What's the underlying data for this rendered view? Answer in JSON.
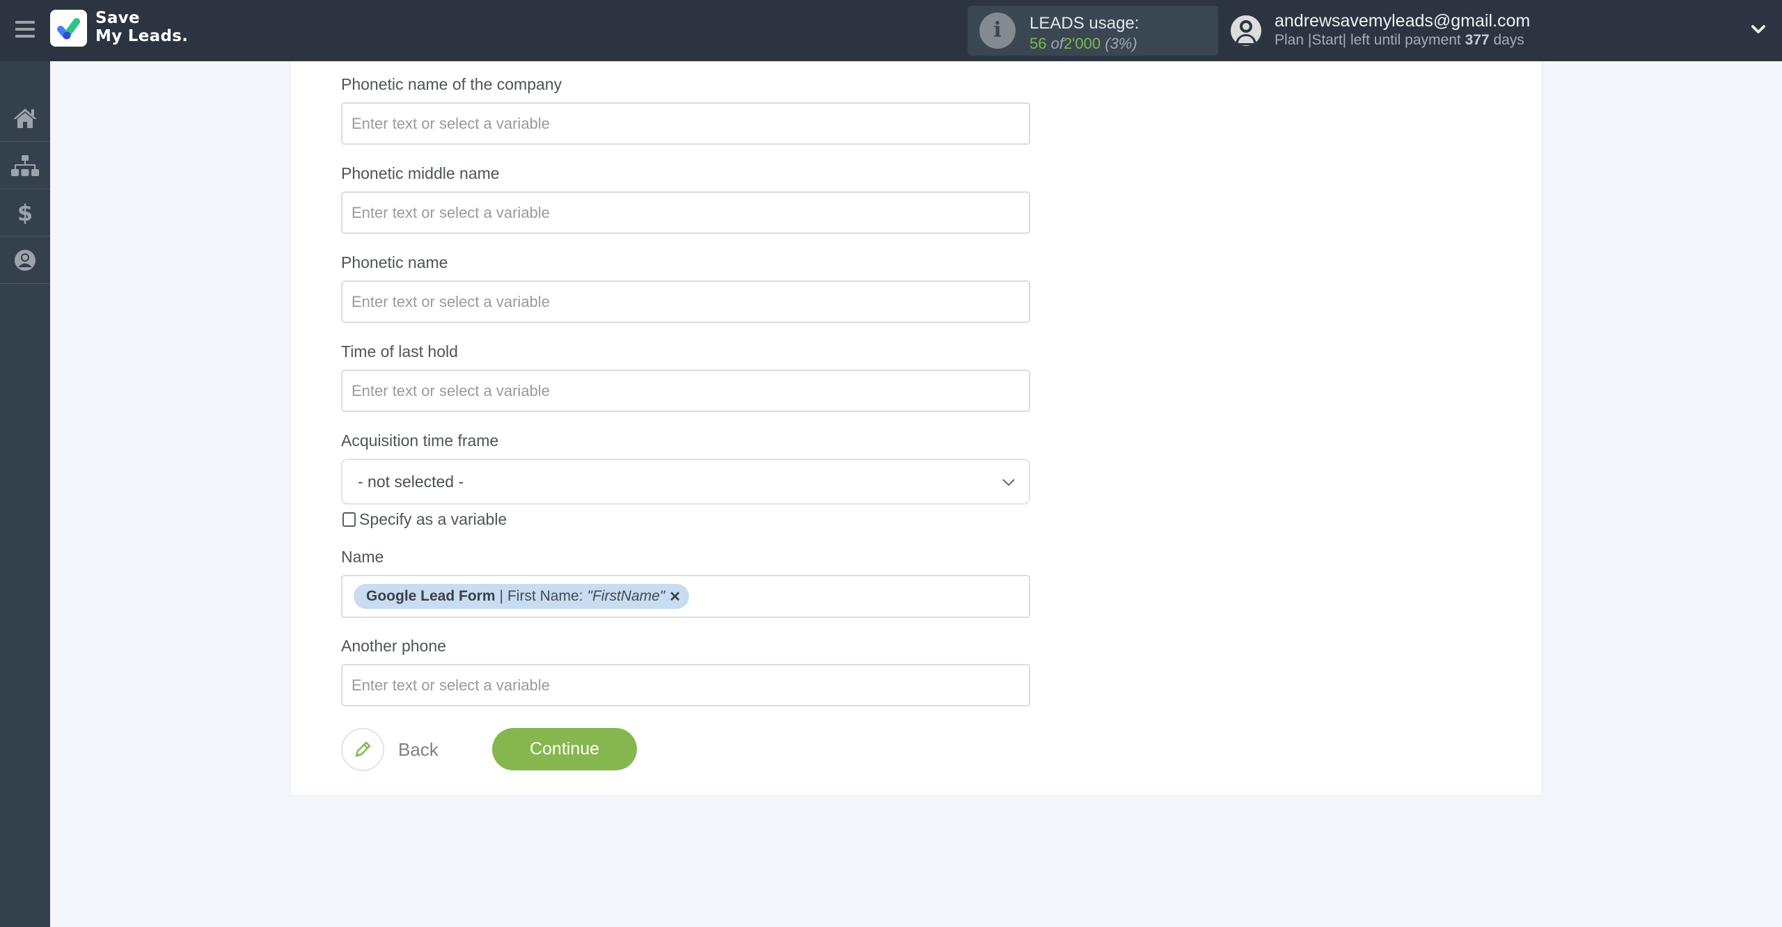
{
  "header": {
    "logo_line1": "Save",
    "logo_line2": "My Leads.",
    "usage": {
      "title": "LEADS usage:",
      "used": "56",
      "of": "of",
      "total": "2'000",
      "percent": "(3%)"
    },
    "user": {
      "email": "andrewsavemyleads@gmail.com",
      "plan_prefix": "Plan |Start| left until payment",
      "days": "377",
      "days_suffix": "days"
    }
  },
  "sidebar": {
    "items": [
      {
        "name": "home",
        "icon": "home-icon"
      },
      {
        "name": "connections",
        "icon": "sitemap-icon"
      },
      {
        "name": "billing",
        "icon": "dollar-icon"
      },
      {
        "name": "account",
        "icon": "user-circle-icon"
      }
    ]
  },
  "form": {
    "fields": [
      {
        "label": "Phonetic name of the company",
        "placeholder": "Enter text or select a variable",
        "value": ""
      },
      {
        "label": "Phonetic middle name",
        "placeholder": "Enter text or select a variable",
        "value": ""
      },
      {
        "label": "Phonetic name",
        "placeholder": "Enter text or select a variable",
        "value": ""
      },
      {
        "label": "Time of last hold",
        "placeholder": "Enter text or select a variable",
        "value": ""
      }
    ],
    "acquisition": {
      "label": "Acquisition time frame",
      "selected": "- not selected -",
      "checkbox_label": "Specify as a variable",
      "checked": false
    },
    "name_field": {
      "label": "Name",
      "chip": {
        "source": "Google Lead Form",
        "separator": "|",
        "field": "First Name:",
        "value": "\"FirstName\"",
        "remove": "✕"
      }
    },
    "another_phone": {
      "label": "Another phone",
      "placeholder": "Enter text or select a variable",
      "value": ""
    },
    "buttons": {
      "back": "Back",
      "continue": "Continue"
    }
  },
  "colors": {
    "header_bg": "#2b3440",
    "sidebar_bg": "#35404d",
    "accent_green": "#86b74f",
    "chip_bg": "#c8dcf2"
  }
}
